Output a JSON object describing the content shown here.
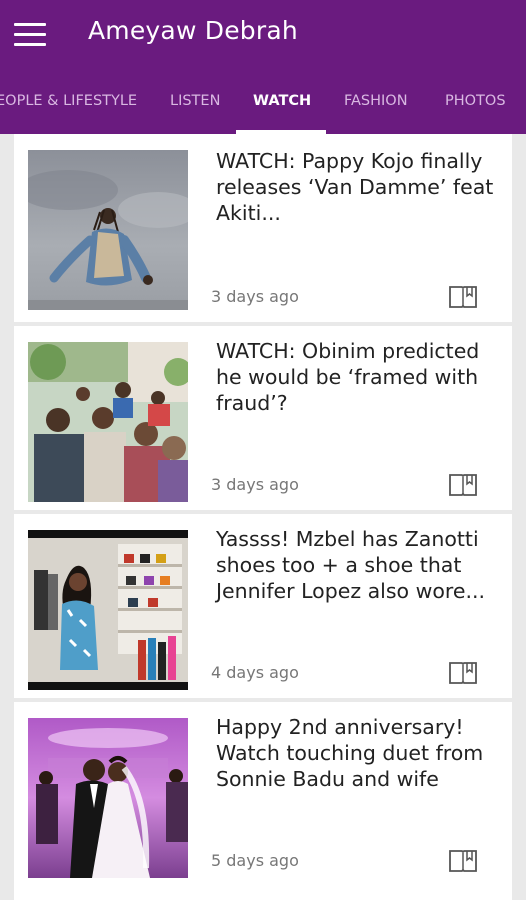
{
  "app": {
    "title": "Ameyaw Debrah"
  },
  "tabs": [
    {
      "label": "EOPLE & LIFESTYLE",
      "active": false
    },
    {
      "label": "LISTEN",
      "active": false
    },
    {
      "label": "WATCH",
      "active": true
    },
    {
      "label": "FASHION",
      "active": false
    },
    {
      "label": "PHOTOS",
      "active": false
    }
  ],
  "articles": [
    {
      "headline": "WATCH: Pappy Kojo finally releases ‘Van Damme’ feat Akiti...",
      "time": "3 days ago"
    },
    {
      "headline": "WATCH: Obinim predicted he would be ‘framed with fraud’?",
      "time": "3 days ago"
    },
    {
      "headline": "Yassss! Mzbel has Zanotti shoes too + a shoe that Jennifer Lopez also wore...",
      "time": "4 days ago"
    },
    {
      "headline": "Happy 2nd anniversary! Watch touching duet from Sonnie Badu and wife",
      "time": "5 days ago"
    }
  ],
  "colors": {
    "appbar": "#6a1b7f",
    "tab_inactive": "#d9b8e2",
    "tab_active": "#ffffff"
  },
  "icons": {
    "menu": "hamburger-menu-icon",
    "bookmark": "bookmark-icon"
  }
}
